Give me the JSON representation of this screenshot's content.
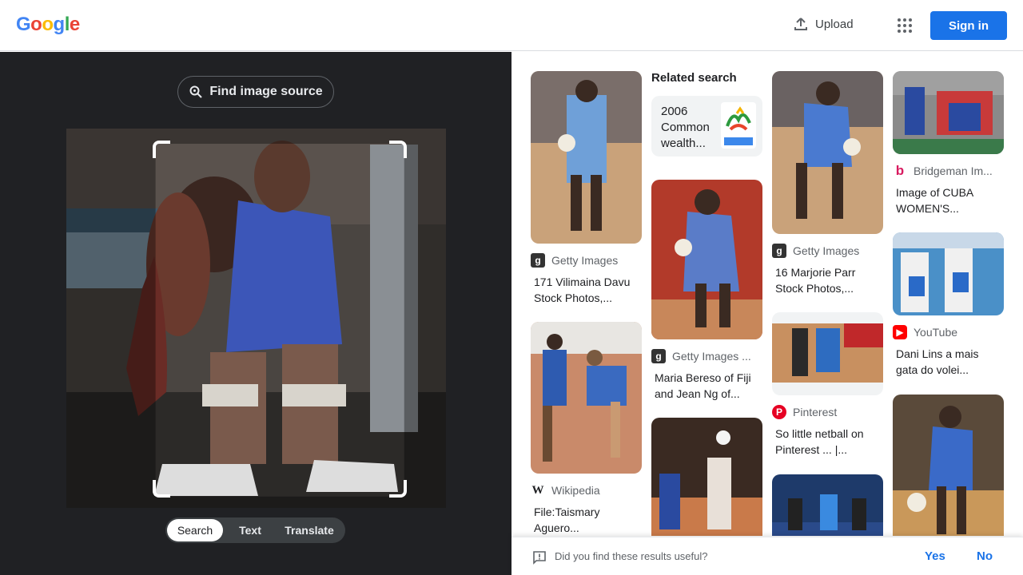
{
  "header": {
    "logo_letters": [
      "G",
      "o",
      "o",
      "g",
      "l",
      "e"
    ],
    "logo_colors": [
      "#4285f4",
      "#ea4335",
      "#fbbc05",
      "#4285f4",
      "#34a853",
      "#ea4335"
    ],
    "upload_label": "Upload",
    "signin_label": "Sign in",
    "apps_icon": "apps-grid-icon"
  },
  "left": {
    "find_source_label": "Find image source",
    "segments": [
      "Search",
      "Text",
      "Translate"
    ],
    "active_segment": "Search"
  },
  "results": {
    "related_heading": "Related search",
    "related_item": {
      "line1": "2006",
      "line2": "Common",
      "line3": "wealth..."
    },
    "cards": [
      {
        "source": "Getty Images",
        "title1": "171 Vilimaina Davu",
        "title2": "Stock Photos,..."
      },
      {
        "source": "Wikipedia",
        "title1": "File:Taismary",
        "title2": "Aguero..."
      },
      {
        "source": "Getty Images ...",
        "title1": "Maria Bereso of Fiji",
        "title2": "and Jean Ng of..."
      },
      {
        "source": "Getty Images",
        "title1": "16 Marjorie Parr",
        "title2": "Stock Photos,..."
      },
      {
        "source": "Pinterest",
        "title1": "So little netball on",
        "title2": "Pinterest ... |..."
      },
      {
        "source": "Bridgeman Im...",
        "title1": "Image of CUBA",
        "title2": "WOMEN'S..."
      },
      {
        "source": "YouTube",
        "title1": "Dani Lins a mais",
        "title2": "gata do volei..."
      }
    ]
  },
  "footer": {
    "question": "Did you find these results useful?",
    "yes": "Yes",
    "no": "No"
  },
  "colors": {
    "accent": "#1a73e8",
    "dark_panel": "#202124"
  }
}
